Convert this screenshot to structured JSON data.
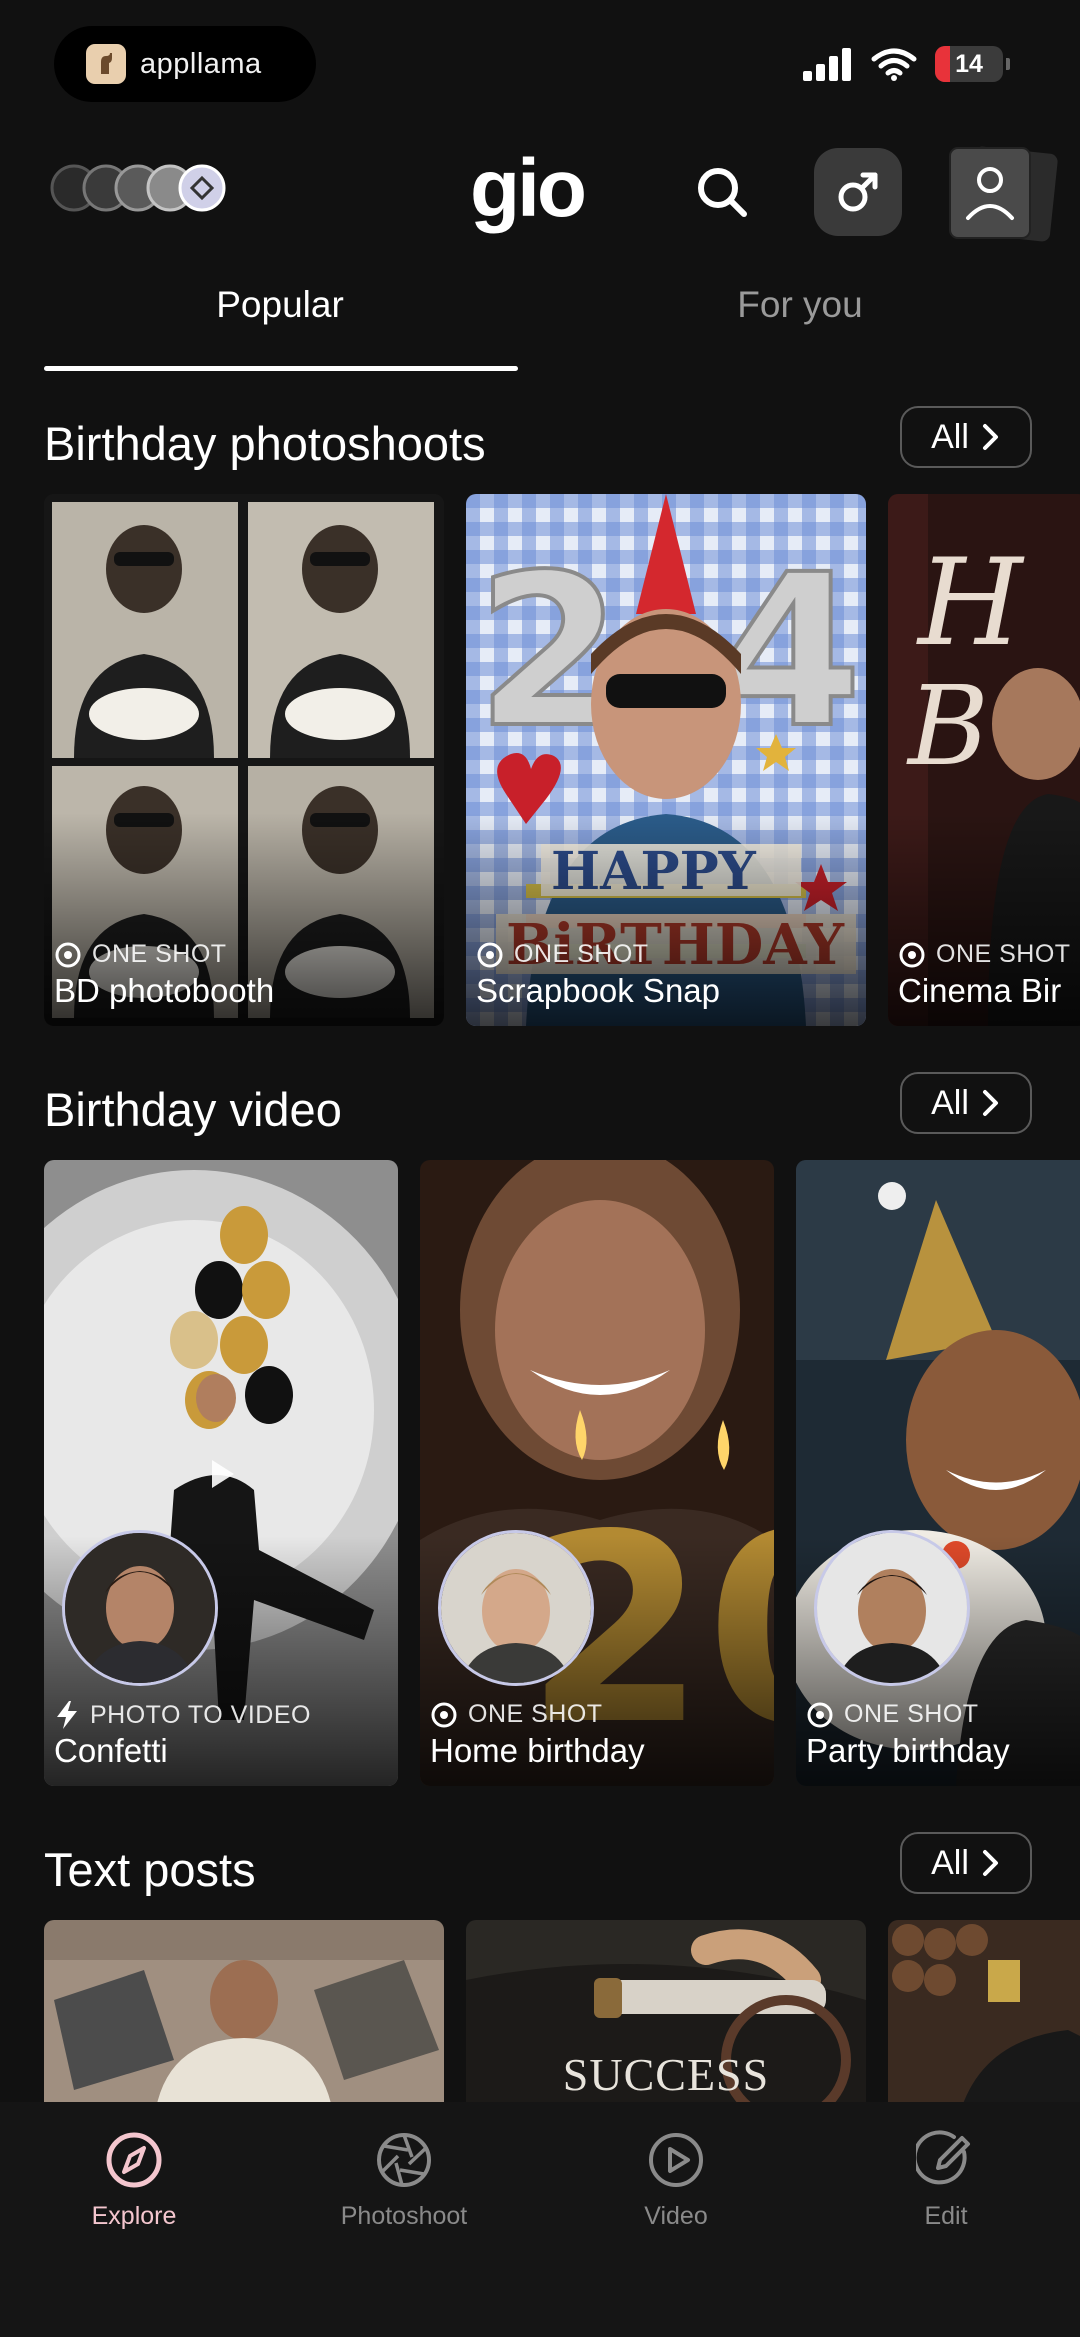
{
  "status_bar": {
    "app_name": "appllama",
    "battery": "14"
  },
  "header": {
    "brand": "gio"
  },
  "tabs": [
    {
      "label": "Popular",
      "active": true
    },
    {
      "label": "For you",
      "active": false
    }
  ],
  "sections": [
    {
      "title": "Birthday photoshoots",
      "all_label": "All",
      "cards": [
        {
          "badge": "ONE SHOT",
          "title": "BD photobooth"
        },
        {
          "badge": "ONE SHOT",
          "title": "Scrapbook Snap"
        },
        {
          "badge": "ONE SHOT",
          "title": "Cinema Bir"
        }
      ]
    },
    {
      "title": "Birthday video",
      "all_label": "All",
      "cards": [
        {
          "badge": "PHOTO TO VIDEO",
          "title": "Confetti",
          "badge_icon": "lightning-icon"
        },
        {
          "badge": "ONE SHOT",
          "title": "Home birthday"
        },
        {
          "badge": "ONE SHOT",
          "title": "Party birthday"
        }
      ]
    },
    {
      "title": "Text posts",
      "all_label": "All",
      "cards": [
        {
          "caption": ""
        },
        {
          "caption": "SUCCESS"
        },
        {
          "caption": ""
        }
      ]
    }
  ],
  "bottom_nav": [
    {
      "label": "Explore",
      "icon": "compass-icon",
      "active": true
    },
    {
      "label": "Photoshoot",
      "icon": "aperture-icon",
      "active": false
    },
    {
      "label": "Video",
      "icon": "play-circle-icon",
      "active": false
    },
    {
      "label": "Edit",
      "icon": "edit-icon",
      "active": false
    }
  ],
  "colors": {
    "background": "#111111",
    "active_tab": "#f4c6ce",
    "battery": "#e8333a"
  }
}
